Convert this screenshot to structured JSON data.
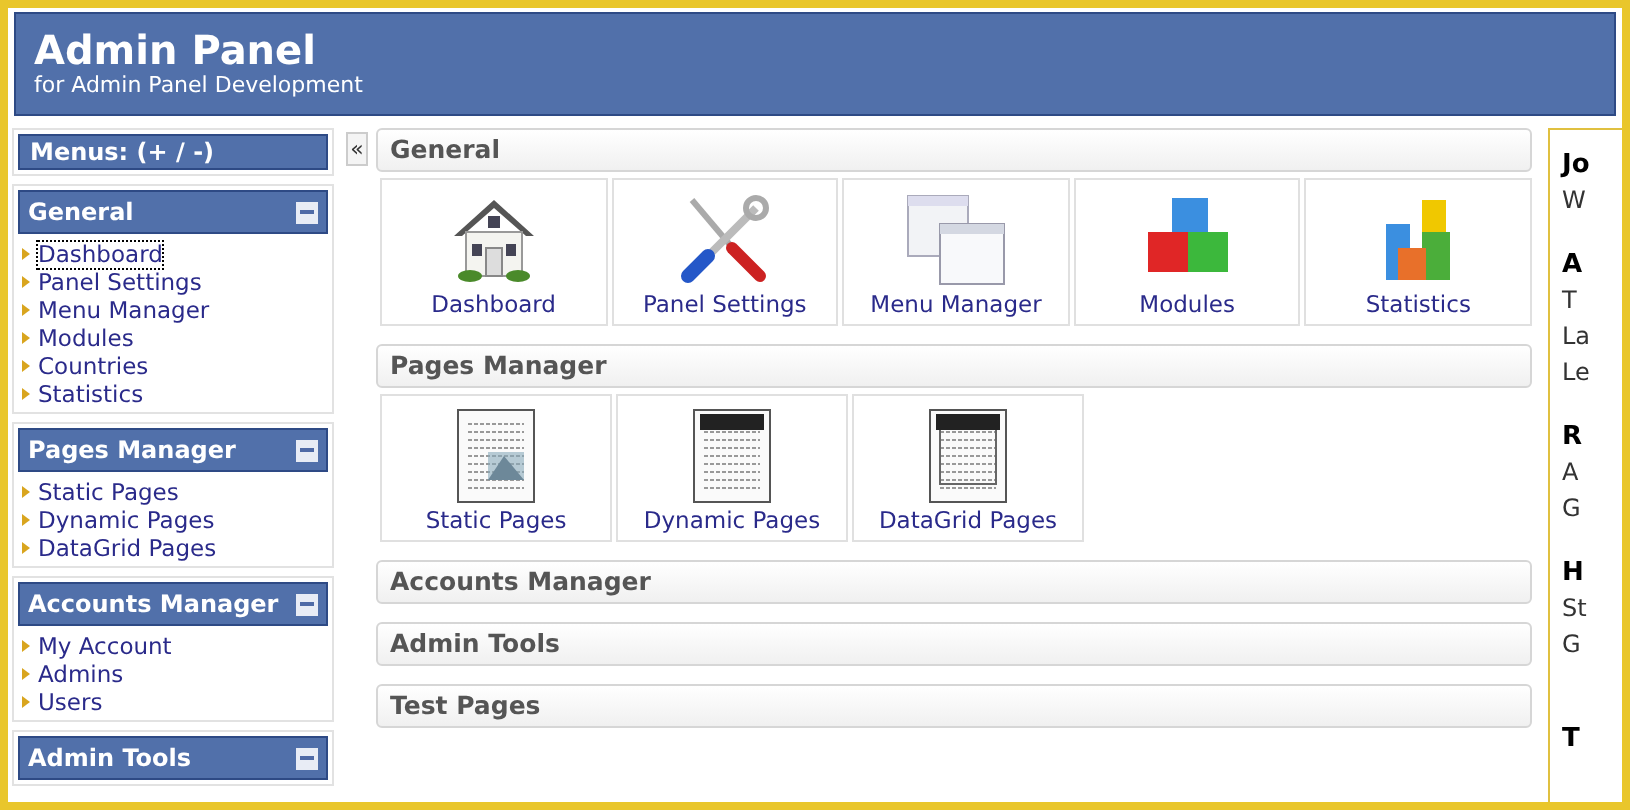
{
  "header": {
    "title": "Admin Panel",
    "subtitle": "for Admin Panel Development"
  },
  "sidebar": {
    "menus_label": "Menus: (+ / -)",
    "sections": [
      {
        "title": "General",
        "expanded": true,
        "items": [
          {
            "label": "Dashboard",
            "selected": true
          },
          {
            "label": "Panel Settings",
            "selected": false
          },
          {
            "label": "Menu Manager",
            "selected": false
          },
          {
            "label": "Modules",
            "selected": false
          },
          {
            "label": "Countries",
            "selected": false
          },
          {
            "label": "Statistics",
            "selected": false
          }
        ]
      },
      {
        "title": "Pages Manager",
        "expanded": true,
        "items": [
          {
            "label": "Static Pages",
            "selected": false
          },
          {
            "label": "Dynamic Pages",
            "selected": false
          },
          {
            "label": "DataGrid Pages",
            "selected": false
          }
        ]
      },
      {
        "title": "Accounts Manager",
        "expanded": true,
        "items": [
          {
            "label": "My Account",
            "selected": false
          },
          {
            "label": "Admins",
            "selected": false
          },
          {
            "label": "Users",
            "selected": false
          }
        ]
      },
      {
        "title": "Admin Tools",
        "expanded": true
      }
    ]
  },
  "collapse_button": "«",
  "main": {
    "sections": [
      {
        "title": "General",
        "tiles": [
          {
            "label": "Dashboard"
          },
          {
            "label": "Panel Settings"
          },
          {
            "label": "Menu Manager"
          },
          {
            "label": "Modules"
          },
          {
            "label": "Statistics"
          }
        ]
      },
      {
        "title": "Pages Manager",
        "tiles": [
          {
            "label": "Static Pages"
          },
          {
            "label": "Dynamic Pages"
          },
          {
            "label": "DataGrid Pages"
          }
        ]
      },
      {
        "title": "Accounts Manager"
      },
      {
        "title": "Admin Tools"
      },
      {
        "title": "Test Pages"
      }
    ]
  },
  "right_panel": {
    "lines": [
      {
        "kind": "heading",
        "text": "Jo"
      },
      {
        "kind": "text",
        "text": "W"
      },
      {
        "kind": "gap"
      },
      {
        "kind": "heading",
        "text": "A"
      },
      {
        "kind": "text",
        "text": "T"
      },
      {
        "kind": "text",
        "text": "La"
      },
      {
        "kind": "text",
        "text": "Le"
      },
      {
        "kind": "gap"
      },
      {
        "kind": "heading",
        "text": "R"
      },
      {
        "kind": "text",
        "text": "A"
      },
      {
        "kind": "text",
        "text": "G"
      },
      {
        "kind": "gap"
      },
      {
        "kind": "heading",
        "text": "H"
      },
      {
        "kind": "text",
        "text": "St"
      },
      {
        "kind": "text",
        "text": "G"
      },
      {
        "kind": "gap"
      },
      {
        "kind": "gap"
      },
      {
        "kind": "heading",
        "text": "T"
      }
    ]
  }
}
